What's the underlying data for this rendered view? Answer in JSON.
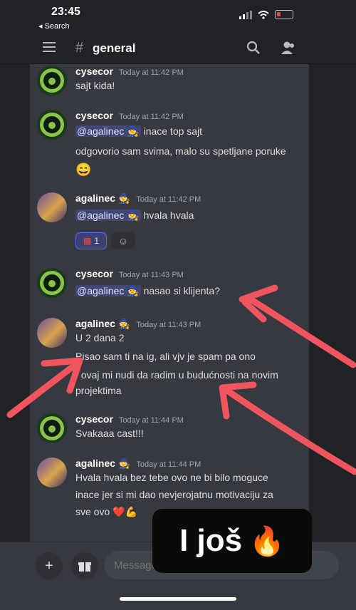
{
  "status_bar": {
    "time": "23:45",
    "back_label": "◂ Search"
  },
  "header": {
    "channel_hash": "#",
    "channel_name": "general"
  },
  "messages": [
    {
      "author": "cysecor",
      "timestamp": "Today at 11:42 PM",
      "lines": [
        "sajt kida!"
      ]
    },
    {
      "author": "cysecor",
      "timestamp": "Today at 11:42 PM",
      "mention": "@agalinec 🧙",
      "lines": [
        "inace top sajt",
        "odgovorio sam svima, malo su spetljane poruke",
        "😄"
      ]
    },
    {
      "author": "agalinec 🧙",
      "timestamp": "Today at 11:42 PM",
      "mention": "@agalinec 🧙",
      "lines": [
        "hvala hvala"
      ],
      "reaction_count": "1"
    },
    {
      "author": "cysecor",
      "timestamp": "Today at 11:43 PM",
      "mention": "@agalinec 🧙",
      "lines": [
        "nasao si klijenta?"
      ]
    },
    {
      "author": "agalinec 🧙",
      "timestamp": "Today at 11:43 PM",
      "lines": [
        "U 2 dana 2",
        "Pisao sam ti na ig, ali vjv je spam pa ono",
        "I ovaj mi nudi da radim u budućnosti na novim",
        "projektima"
      ]
    },
    {
      "author": "cysecor",
      "timestamp": "Today at 11:44 PM",
      "lines": [
        "Svakaaa cast!!!"
      ]
    },
    {
      "author": "agalinec 🧙",
      "timestamp": "Today at 11:44 PM",
      "lines": [
        "Hvala hvala bez tebe ovo ne bi bilo moguce",
        "inace jer si mi dao nevjerojatnu motivaciju za",
        "sve ovo ❤️💪"
      ]
    }
  ],
  "composer": {
    "placeholder": "Message #general"
  },
  "story_overlay": {
    "text": "I još",
    "emoji": "🔥"
  },
  "colors": {
    "accent": "#5865f2",
    "mention_bg": "#414675",
    "arrow": "#f0545e"
  }
}
